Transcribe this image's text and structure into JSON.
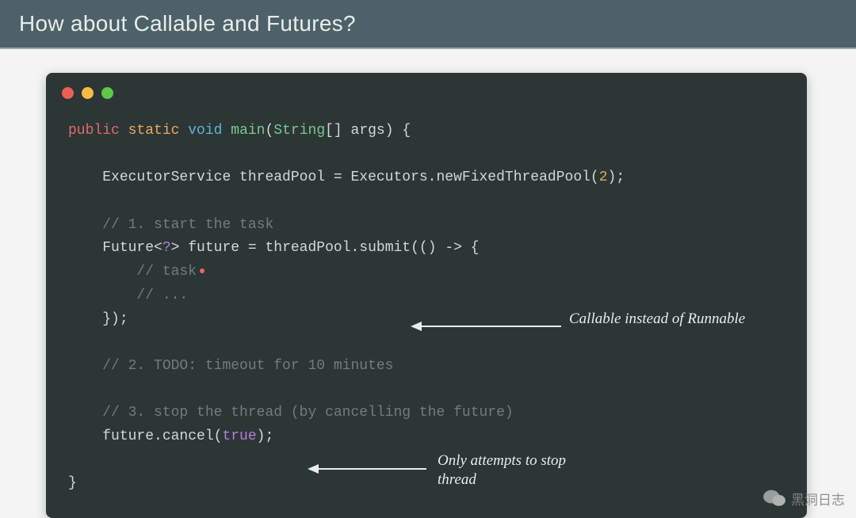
{
  "header": {
    "title": "How about Callable and Futures?"
  },
  "code": {
    "kw_public": "public",
    "kw_static": "static",
    "kw_void": "void",
    "fn_main": "main",
    "type_string": "String",
    "args": "[] args) {",
    "exec_line_a": "ExecutorService threadPool = Executors.newFixedThreadPool(",
    "exec_pool_size": "2",
    "exec_line_b": ");",
    "comment_start": "// 1. start the task",
    "future_decl_a": "Future<",
    "future_generic": "?",
    "future_decl_b": "> future = threadPool.submit(() -> {",
    "comment_task": "// task",
    "comment_dots": "// ...",
    "close_lambda": "});",
    "comment_todo": "// 2. TODO: timeout for 10 minutes",
    "comment_stop": "// 3. stop the thread (by cancelling the future)",
    "cancel_a": "future.cancel(",
    "cancel_bool": "true",
    "cancel_b": ");",
    "close_brace": "}"
  },
  "annotations": {
    "callable": "Callable instead of Runnable",
    "stop1": "Only attempts to stop",
    "stop2": "thread"
  },
  "watermark": {
    "text": "黑洞日志"
  }
}
